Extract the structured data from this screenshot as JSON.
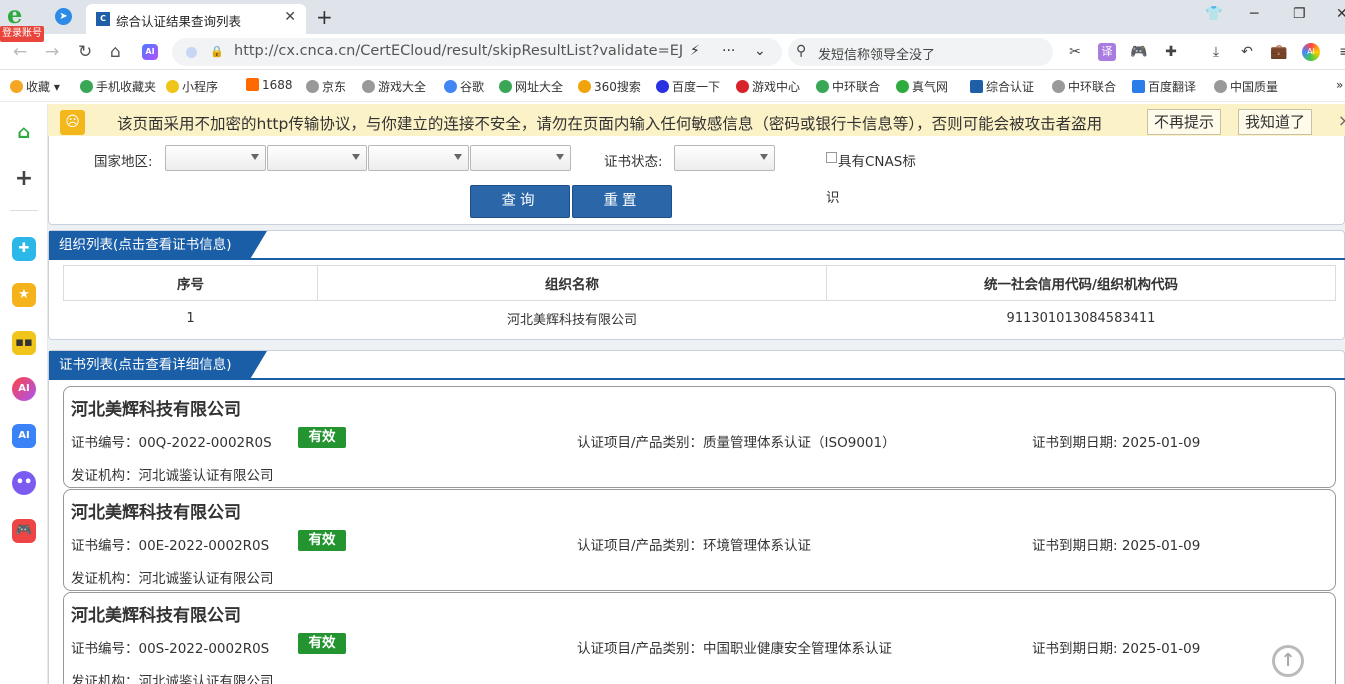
{
  "browser": {
    "login_badge": "登录账号",
    "tab": {
      "title": "综合认证结果查询列表",
      "favicon": "C"
    },
    "url": "http://cx.cnca.cn/CertECloud/result/skipResultList?validate=EJRN&",
    "search_text": "发短信称领导全没了"
  },
  "bookmarks": [
    {
      "label": "收藏",
      "color": "#f5a623"
    },
    {
      "label": "手机收藏夹",
      "color": "#3aa757"
    },
    {
      "label": "小程序",
      "color": "#f0c419"
    },
    {
      "label": "1688",
      "color": "#ff6a00"
    },
    {
      "label": "京东",
      "color": "#999999"
    },
    {
      "label": "游戏大全",
      "color": "#999999"
    },
    {
      "label": "谷歌",
      "color": "#4285f4"
    },
    {
      "label": "网址大全",
      "color": "#3aa757"
    },
    {
      "label": "360搜索",
      "color": "#f0a30a"
    },
    {
      "label": "百度一下",
      "color": "#2932e1"
    },
    {
      "label": "游戏中心",
      "color": "#d8232a"
    },
    {
      "label": "中环联合",
      "color": "#3aa757"
    },
    {
      "label": "真气网",
      "color": "#2eaa3f"
    },
    {
      "label": "综合认证",
      "color": "#1f5fa8"
    },
    {
      "label": "中环联合",
      "color": "#999999"
    },
    {
      "label": "百度翻译",
      "color": "#2b7de9"
    },
    {
      "label": "中国质量",
      "color": "#999999"
    }
  ],
  "warning": {
    "text": "该页面采用不加密的http传输协议，与你建立的连接不安全，请勿在页面内输入任何敏感信息（密码或银行卡信息等），否则可能会被攻击者盗用",
    "btn_no_remind": "不再提示",
    "btn_ok": "我知道了",
    "close": "×"
  },
  "search_form": {
    "region_label": "国家地区:",
    "status_label": "证书状态:",
    "cnas_label": "具有CNAS标",
    "cnas_label_wrap": "识",
    "query_btn": "查询",
    "reset_btn": "重置"
  },
  "org_section": {
    "title": "组织列表(点击查看证书信息)",
    "headers": [
      "序号",
      "组织名称",
      "统一社会信用代码/组织机构代码"
    ],
    "rows": [
      {
        "no": "1",
        "name": "河北美辉科技有限公司",
        "code": "911301013084583411"
      }
    ]
  },
  "cert_section": {
    "title": "证书列表(点击查看详细信息)",
    "certs": [
      {
        "org_name": "河北美辉科技有限公司",
        "cert_no": "证书编号：00Q-2022-0002R0S",
        "status": "有效",
        "project": "认证项目/产品类别：质量管理体系认证（ISO9001）",
        "expiry": "证书到期日期: 2025-01-09",
        "issuer": "发证机构：河北诚鉴认证有限公司"
      },
      {
        "org_name": "河北美辉科技有限公司",
        "cert_no": "证书编号：00E-2022-0002R0S",
        "status": "有效",
        "project": "认证项目/产品类别：环境管理体系认证",
        "expiry": "证书到期日期: 2025-01-09",
        "issuer": "发证机构：河北诚鉴认证有限公司"
      },
      {
        "org_name": "河北美辉科技有限公司",
        "cert_no": "证书编号：00S-2022-0002R0S",
        "status": "有效",
        "project": "认证项目/产品类别：中国职业健康安全管理体系认证",
        "expiry": "证书到期日期: 2025-01-09",
        "issuer": "发证机构：河北诚鉴认证有限公司"
      }
    ]
  },
  "colors": {
    "accent": "#1a5ea8",
    "valid_badge": "#249430",
    "warning_bg": "#fcf2c7"
  }
}
